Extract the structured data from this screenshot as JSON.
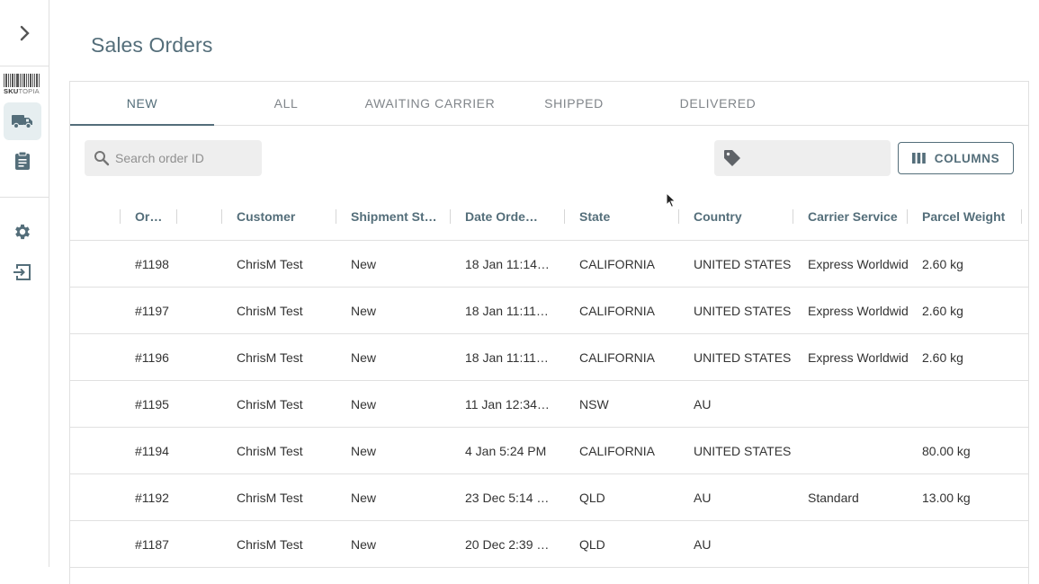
{
  "page": {
    "title": "Sales Orders"
  },
  "sidebar": {
    "logo_text_bold": "SKU",
    "logo_text_light": "TOPIA",
    "items": [
      {
        "name": "truck-icon",
        "active": true
      },
      {
        "name": "clipboard-icon",
        "active": false
      },
      {
        "name": "gear-icon",
        "active": false
      },
      {
        "name": "logout-icon",
        "active": false
      }
    ]
  },
  "tabs": [
    {
      "label": "NEW",
      "active": true
    },
    {
      "label": "ALL",
      "active": false
    },
    {
      "label": "AWAITING CARRIER",
      "active": false
    },
    {
      "label": "SHIPPED",
      "active": false
    },
    {
      "label": "DELIVERED",
      "active": false
    }
  ],
  "toolbar": {
    "search_placeholder": "Search order ID",
    "columns_label": "COLUMNS"
  },
  "table": {
    "headers": [
      "Or…",
      "",
      "Customer",
      "Shipment St…",
      "Date Orde…",
      "State",
      "Country",
      "Carrier Service",
      "Parcel Weight"
    ],
    "rows": [
      [
        "#1198",
        "",
        "ChrisM Test",
        "New",
        "18 Jan 11:14…",
        "CALIFORNIA",
        "UNITED STATES",
        "Express Worldwide",
        "2.60 kg"
      ],
      [
        "#1197",
        "",
        "ChrisM Test",
        "New",
        "18 Jan 11:11…",
        "CALIFORNIA",
        "UNITED STATES",
        "Express Worldwide",
        "2.60 kg"
      ],
      [
        "#1196",
        "",
        "ChrisM Test",
        "New",
        "18 Jan 11:11…",
        "CALIFORNIA",
        "UNITED STATES",
        "Express Worldwide",
        "2.60 kg"
      ],
      [
        "#1195",
        "",
        "ChrisM Test",
        "New",
        "11 Jan 12:34…",
        "NSW",
        "AU",
        "",
        ""
      ],
      [
        "#1194",
        "",
        "ChrisM Test",
        "New",
        "4 Jan 5:24 PM",
        "CALIFORNIA",
        "UNITED STATES",
        "",
        "80.00 kg"
      ],
      [
        "#1192",
        "",
        "ChrisM Test",
        "New",
        "23 Dec 5:14 …",
        "QLD",
        "AU",
        "Standard",
        "13.00 kg"
      ],
      [
        "#1187",
        "",
        "ChrisM Test",
        "New",
        "20 Dec 2:39 …",
        "QLD",
        "AU",
        "",
        ""
      ]
    ]
  },
  "colors": {
    "accent": "#546e7a",
    "border": "#e0e0e0",
    "field_bg": "#eeeeee"
  }
}
